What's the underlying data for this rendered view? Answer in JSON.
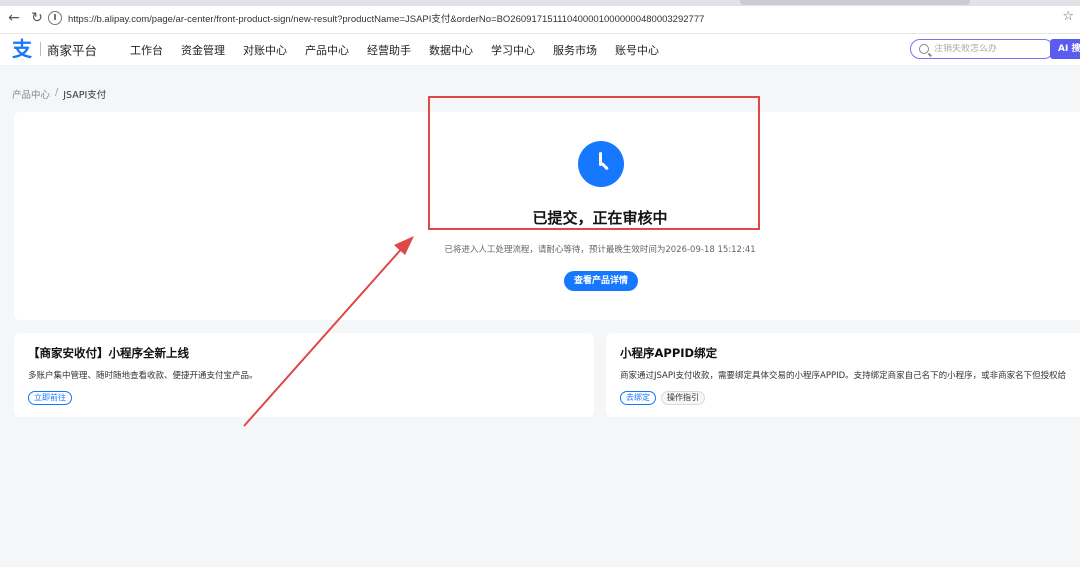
{
  "browser": {
    "url": "https://b.alipay.com/page/ar-center/front-product-sign/new-result?productName=JSAPI支付&orderNo=BO2609171511104000010000000480003292777"
  },
  "header": {
    "logo_mark": "支",
    "logo_text": "商家平台",
    "nav": [
      "工作台",
      "资金管理",
      "对账中心",
      "产品中心",
      "经营助手",
      "数据中心",
      "学习中心",
      "服务市场",
      "账号中心"
    ],
    "search_placeholder": "注销失败怎么办",
    "ai_label": "AI 搜"
  },
  "breadcrumb": {
    "parent": "产品中心",
    "separator": "/",
    "current": "JSAPI支付"
  },
  "result": {
    "title": "已提交，正在审核中",
    "description": "已将进入人工处理流程，请耐心等待，预计最晚生效时间为2026-09-18 15:12:41",
    "button_label": "查看产品详情"
  },
  "cards": [
    {
      "title": "【商家安收付】小程序全新上线",
      "description": "多账户集中管理、随时随地查看收款、便捷开通支付宝产品。",
      "actions": [
        "立即前往"
      ]
    },
    {
      "title": "小程序APPID绑定",
      "description": "商家通过JSAPI支付收款，需要绑定具体交易的小程序APPID。支持绑定商家自己名下的小程序，或非商家名下但授权给",
      "actions": [
        "去绑定",
        "操作指引"
      ]
    }
  ],
  "colors": {
    "brand": "#1677ff",
    "annotation": "#e04848",
    "ai": "#5b5bf0"
  }
}
